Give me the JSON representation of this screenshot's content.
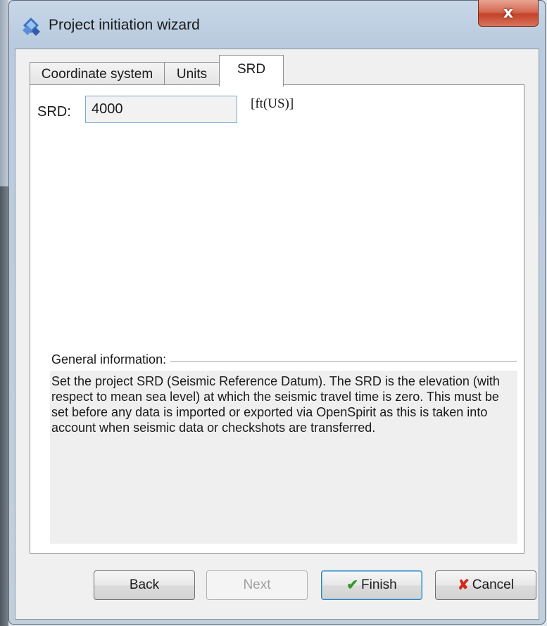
{
  "window": {
    "title": "Project initiation wizard",
    "close_glyph": "x",
    "app_icon": "wizard-app-icon"
  },
  "tabs": [
    {
      "label": "Coordinate system",
      "active": false
    },
    {
      "label": "Units",
      "active": false
    },
    {
      "label": "SRD",
      "active": true
    }
  ],
  "srd": {
    "label": "SRD:",
    "value": "4000",
    "unit": "[ft(US)]"
  },
  "general_info": {
    "header": "General information:",
    "text": "Set the project SRD (Seismic Reference Datum). The SRD is the elevation (with respect to mean sea level) at which the seismic travel time is zero.  This must be set before any data is imported or exported via OpenSpirit as this is taken into account when seismic data or checkshots are transferred."
  },
  "buttons": {
    "back": "Back",
    "next": "Next",
    "finish": "Finish",
    "cancel": "Cancel",
    "finish_icon": "check-icon",
    "cancel_icon": "cross-icon"
  },
  "colors": {
    "close_button": "#c3432a",
    "check_icon": "#2f9b25",
    "cancel_icon": "#d42a1e",
    "input_border": "#7aa7d6"
  }
}
